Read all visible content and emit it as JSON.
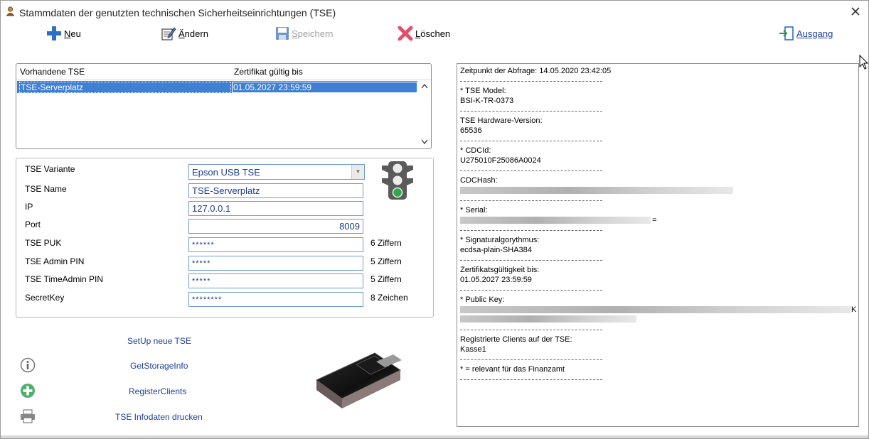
{
  "window": {
    "title": "Stammdaten der genutzten technischen Sicherheitseinrichtungen (TSE)"
  },
  "toolbar": {
    "new_label_u": "N",
    "new_label_rest": "eu",
    "edit_label_u": "Ä",
    "edit_label_rest": "ndern",
    "save_label_u": "S",
    "save_label_rest": "peichern",
    "delete_label_u": "L",
    "delete_label_rest": "öschen",
    "exit_label": "Ausgang"
  },
  "tse_list": {
    "headers": [
      "Vorhandene TSE",
      "Zertifikat gültig bis"
    ],
    "rows": [
      {
        "name": "TSE-Serverplatz",
        "valid_until": "01.05.2027 23:59:59"
      }
    ]
  },
  "form": {
    "variant_label": "TSE Variante",
    "variant_value": "Epson USB TSE",
    "name_label": "TSE Name",
    "name_value": "TSE-Serverplatz",
    "ip_label": "IP",
    "ip_value": "127.0.0.1",
    "port_label": "Port",
    "port_value": "8009",
    "puk_label": "TSE PUK",
    "puk_value": "******",
    "puk_hint": "6 Ziffern",
    "admin_pin_label": "TSE Admin PIN",
    "admin_pin_value": "*****",
    "admin_pin_hint": "5 Ziffern",
    "timeadmin_pin_label": "TSE TimeAdmin PIN",
    "timeadmin_pin_value": "*****",
    "timeadmin_pin_hint": "5 Ziffern",
    "secretkey_label": "SecretKey",
    "secretkey_value": "********",
    "secretkey_hint": "8 Zeichen",
    "status_color": "#2ea84a"
  },
  "actions": {
    "setup": "SetUp neue TSE",
    "storage_info": "GetStorageInfo",
    "register_clients": "RegisterClients",
    "print_info": "TSE Infodaten drucken"
  },
  "info": {
    "query_time": "Zeitpunkt der Abfrage: 14.05.2020 23:42:05",
    "model_label": "* TSE Model:",
    "model_value": "BSI-K-TR-0373",
    "hw_label": "TSE Hardware-Version:",
    "hw_value": "65536",
    "cdcid_label": "* CDCId:",
    "cdcid_value": "U275010F25086A0024",
    "cdchash_label": "CDCHash:",
    "serial_label": "* Serial:",
    "serial_suffix": "=",
    "sig_label": "* Signaturalgorythmus:",
    "sig_value": "ecdsa-plain-SHA384",
    "cert_label": "Zertifikatsgültigkeit bis:",
    "cert_value": "01.05.2027 23:59:59",
    "pubkey_label": "* Public Key:",
    "pubkey_suffix": "K",
    "clients_label": "Registrierte Clients auf der TSE:",
    "clients_value": "Kasse1",
    "footnote": "* = relevant für das Finanzamt",
    "separator": "------------------------------------------------------"
  },
  "colors": {
    "selection": "#3f7fd4",
    "link": "#1c3fa0",
    "input_border": "#6d9bd4"
  }
}
